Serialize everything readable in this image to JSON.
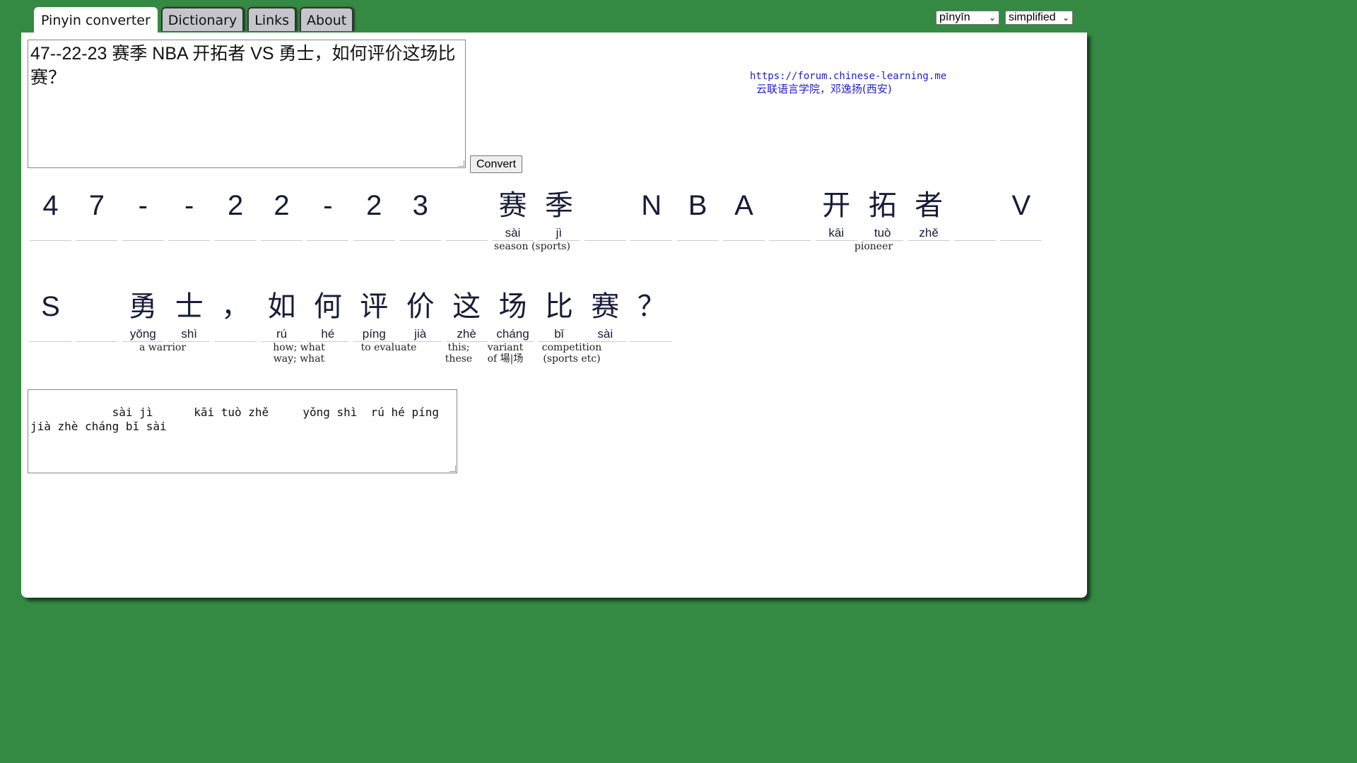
{
  "tabs": [
    "Pinyin converter",
    "Dictionary",
    "Links",
    "About"
  ],
  "active_tab": 0,
  "selects": {
    "romanization": "pīnyīn",
    "script": "simplified"
  },
  "input_text": "47--22-23 赛季 NBA 开拓者 VS 勇士，如何评价这场比赛？",
  "convert_label": "Convert",
  "credit": {
    "source": "https://forum.chinese-learning.me",
    "school": "云联语言学院，邓逸扬(西安)"
  },
  "row1": {
    "chars": [
      "4",
      "7",
      "-",
      "-",
      "2",
      "2",
      "-",
      "2",
      "3",
      "",
      "赛",
      "季",
      "",
      "N",
      "B",
      "A",
      "",
      "开",
      "拓",
      "者",
      "",
      "V"
    ],
    "pinyin": [
      "",
      "",
      "",
      "",
      "",
      "",
      "",
      "",
      "",
      "",
      "sài",
      "jì",
      "",
      "",
      "",
      "",
      "",
      "kāi",
      "tuò",
      "zhě",
      "",
      ""
    ]
  },
  "row2": {
    "chars": [
      "S",
      "",
      "勇",
      "士",
      "，",
      "如",
      "何",
      "评",
      "价",
      "这",
      "场",
      "比",
      "赛",
      "？"
    ],
    "pinyin": [
      "",
      "",
      "yǒng",
      "shì",
      "",
      "rú",
      "hé",
      "píng",
      "jià",
      "zhè",
      "cháng",
      "bǐ",
      "sài",
      ""
    ]
  },
  "glosses": {
    "season": "season (sports)",
    "pioneer": "pioneer",
    "warrior": "a warrior",
    "how": "how; what way; what",
    "evaluate": "to evaluate",
    "this": "this; these",
    "chang": "variant of 場|场",
    "competition": "competition (sports etc)"
  },
  "output_text": "        sài jì      kāi tuò zhě     yǒng shì  rú hé píng jià zhè cháng bǐ sài"
}
